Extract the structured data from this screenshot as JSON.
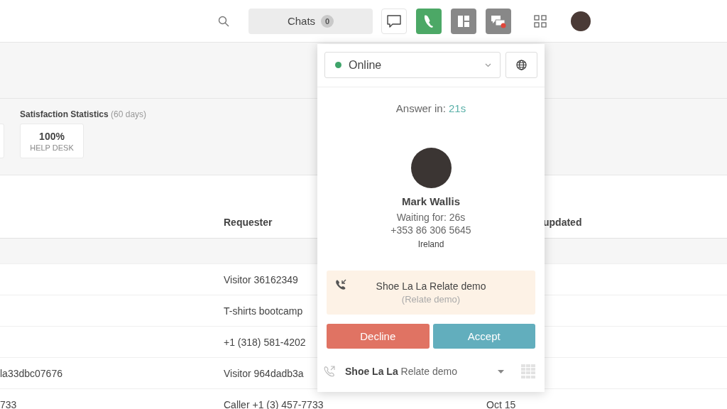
{
  "topbar": {
    "chats": {
      "label": "Chats",
      "count": "0"
    },
    "toolbar_buttons": [
      {
        "kind": "chat",
        "selected": false
      },
      {
        "kind": "phone",
        "selected": true
      },
      {
        "kind": "layout",
        "selected": false
      },
      {
        "kind": "chat-alert",
        "selected": false
      }
    ]
  },
  "stats": {
    "title": "Satisfaction Statistics",
    "period": "(60 days)",
    "cards": [
      {
        "value": "100%",
        "label": "HELP DESK"
      }
    ]
  },
  "table": {
    "header": {
      "requester": "Requester",
      "column_3": "updated"
    },
    "rows": [
      {
        "requester": "Visitor 36162349"
      },
      {
        "requester": "T-shirts bootcamp"
      },
      {
        "requester": "+1 (318) 581-4202"
      },
      {
        "column_1": "la33dbc07676",
        "requester": "Visitor 964dadb3a"
      },
      {
        "column_1": "733",
        "requester": "Caller +1 (3) 457-7733",
        "column_3": "Oct 15"
      }
    ]
  },
  "call_popover": {
    "status": {
      "label": "Online",
      "online": true
    },
    "answer_in": {
      "label": "Answer in:",
      "value": "21s"
    },
    "caller": {
      "name": "Mark Wallis",
      "waiting": "Waiting for: 26s",
      "phone": "+353 86 306 5645",
      "country": "Ireland"
    },
    "line": {
      "title": "Shoe La La Relate demo",
      "subtitle": "(Relate demo)"
    },
    "actions": [
      {
        "kind": "decline",
        "label": "Decline"
      },
      {
        "kind": "accept",
        "label": "Accept"
      }
    ],
    "footer": {
      "line": "**Shoe La La** Relate demo"
    }
  }
}
